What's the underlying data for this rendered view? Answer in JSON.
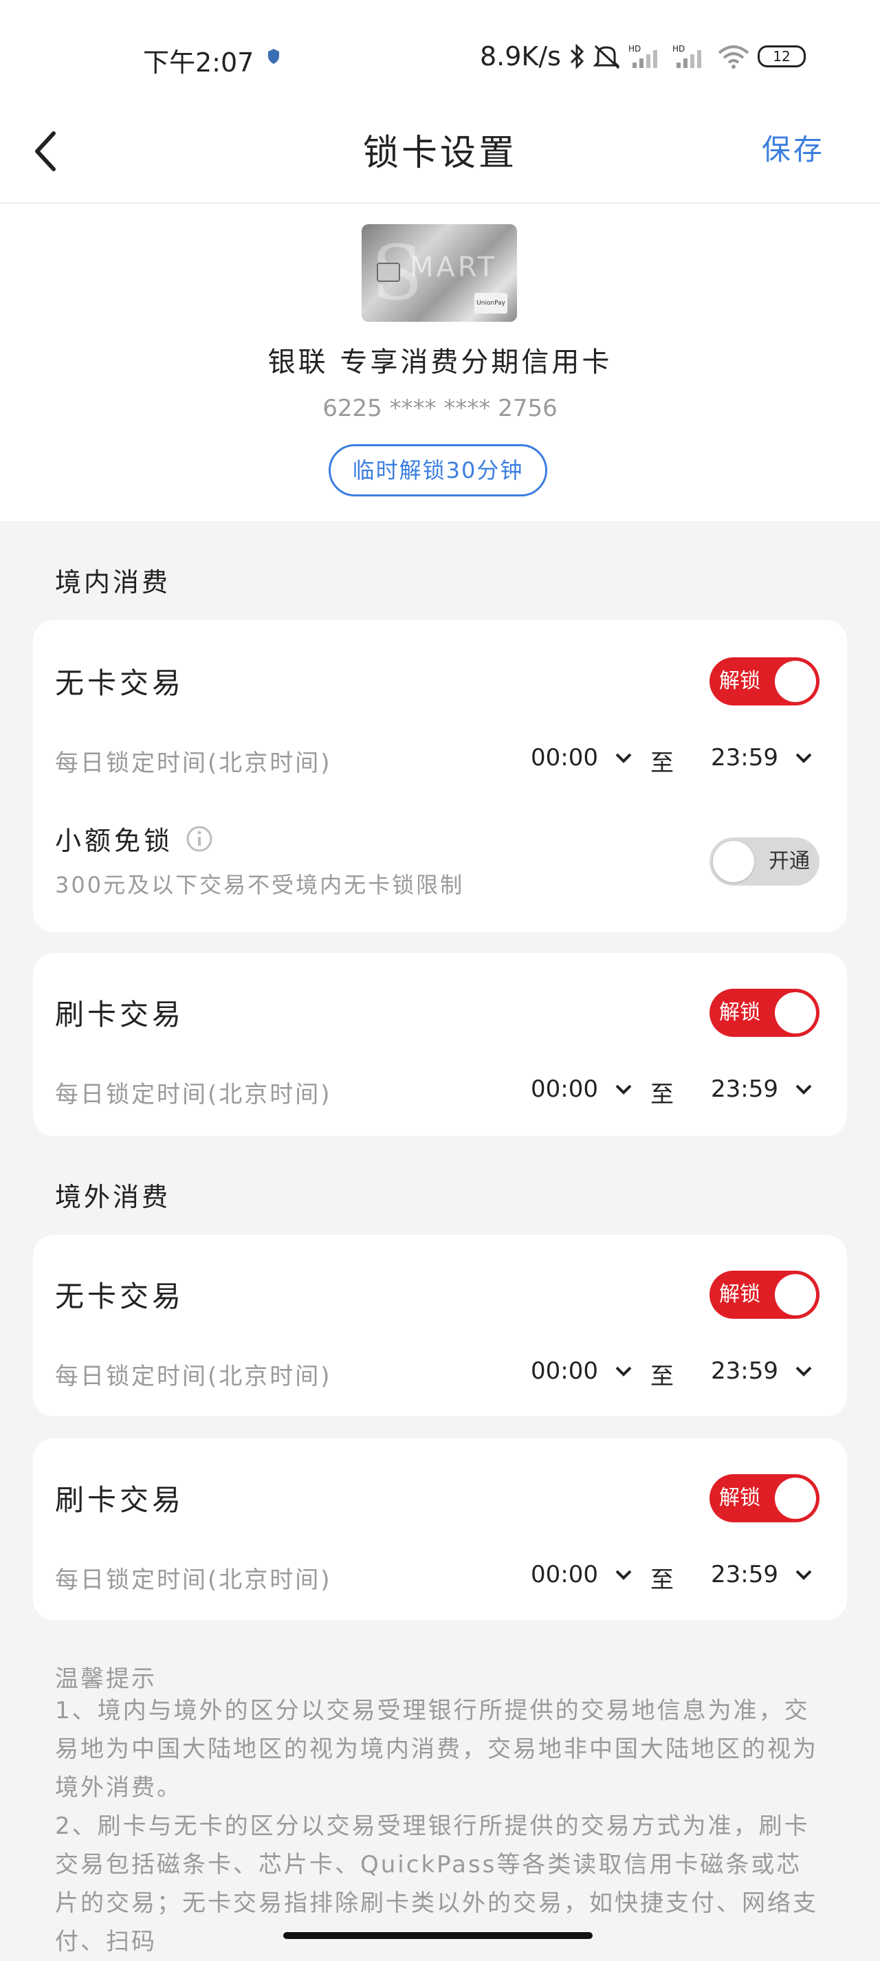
{
  "status_bar": {
    "time": "下午2:07",
    "speed": "8.9K/s",
    "battery": "12"
  },
  "nav": {
    "title": "锁卡设置",
    "save": "保存"
  },
  "card": {
    "name": "银联 专享消费分期信用卡",
    "number": "6225 **** **** 2756",
    "temp_unlock": "临时解锁30分钟"
  },
  "domestic": {
    "title": "境内消费",
    "no_card": {
      "title": "无卡交易",
      "toggle": "解锁",
      "time_label": "每日锁定时间(北京时间)",
      "start": "00:00",
      "to": "至",
      "end": "23:59"
    },
    "small_amount": {
      "title": "小额免锁",
      "desc": "300元及以下交易不受境内无卡锁限制",
      "toggle": "开通"
    },
    "card_swipe": {
      "title": "刷卡交易",
      "toggle": "解锁",
      "time_label": "每日锁定时间(北京时间)",
      "start": "00:00",
      "to": "至",
      "end": "23:59"
    }
  },
  "overseas": {
    "title": "境外消费",
    "no_card": {
      "title": "无卡交易",
      "toggle": "解锁",
      "time_label": "每日锁定时间(北京时间)",
      "start": "00:00",
      "to": "至",
      "end": "23:59"
    },
    "card_swipe": {
      "title": "刷卡交易",
      "toggle": "解锁",
      "time_label": "每日锁定时间(北京时间)",
      "start": "00:00",
      "to": "至",
      "end": "23:59"
    }
  },
  "tips": {
    "title": "温馨提示",
    "p1": "1、境内与境外的区分以交易受理银行所提供的交易地信息为准，交易地为中国大陆地区的视为境内消费，交易地非中国大陆地区的视为境外消费。",
    "p2": "2、刷卡与无卡的区分以交易受理银行所提供的交易方式为准，刷卡交易包括磁条卡、芯片卡、QuickPass等各类读取信用卡磁条或芯片的交易；无卡交易指排除刷卡类以外的交易，如快捷支付、网络支付、扫码"
  },
  "colors": {
    "accent_blue": "#3b7ee0",
    "toggle_red": "#e01e26"
  }
}
